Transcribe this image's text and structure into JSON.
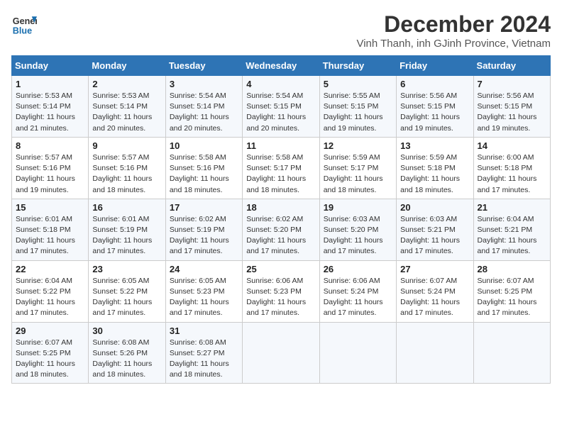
{
  "header": {
    "logo_line1": "General",
    "logo_line2": "Blue",
    "title": "December 2024",
    "subtitle": "Vinh Thanh, inh GJinh Province, Vietnam"
  },
  "calendar": {
    "headers": [
      "Sunday",
      "Monday",
      "Tuesday",
      "Wednesday",
      "Thursday",
      "Friday",
      "Saturday"
    ],
    "weeks": [
      [
        {
          "day": "1",
          "info": "Sunrise: 5:53 AM\nSunset: 5:14 PM\nDaylight: 11 hours\nand 21 minutes."
        },
        {
          "day": "2",
          "info": "Sunrise: 5:53 AM\nSunset: 5:14 PM\nDaylight: 11 hours\nand 20 minutes."
        },
        {
          "day": "3",
          "info": "Sunrise: 5:54 AM\nSunset: 5:14 PM\nDaylight: 11 hours\nand 20 minutes."
        },
        {
          "day": "4",
          "info": "Sunrise: 5:54 AM\nSunset: 5:15 PM\nDaylight: 11 hours\nand 20 minutes."
        },
        {
          "day": "5",
          "info": "Sunrise: 5:55 AM\nSunset: 5:15 PM\nDaylight: 11 hours\nand 19 minutes."
        },
        {
          "day": "6",
          "info": "Sunrise: 5:56 AM\nSunset: 5:15 PM\nDaylight: 11 hours\nand 19 minutes."
        },
        {
          "day": "7",
          "info": "Sunrise: 5:56 AM\nSunset: 5:15 PM\nDaylight: 11 hours\nand 19 minutes."
        }
      ],
      [
        {
          "day": "8",
          "info": "Sunrise: 5:57 AM\nSunset: 5:16 PM\nDaylight: 11 hours\nand 19 minutes."
        },
        {
          "day": "9",
          "info": "Sunrise: 5:57 AM\nSunset: 5:16 PM\nDaylight: 11 hours\nand 18 minutes."
        },
        {
          "day": "10",
          "info": "Sunrise: 5:58 AM\nSunset: 5:16 PM\nDaylight: 11 hours\nand 18 minutes."
        },
        {
          "day": "11",
          "info": "Sunrise: 5:58 AM\nSunset: 5:17 PM\nDaylight: 11 hours\nand 18 minutes."
        },
        {
          "day": "12",
          "info": "Sunrise: 5:59 AM\nSunset: 5:17 PM\nDaylight: 11 hours\nand 18 minutes."
        },
        {
          "day": "13",
          "info": "Sunrise: 5:59 AM\nSunset: 5:18 PM\nDaylight: 11 hours\nand 18 minutes."
        },
        {
          "day": "14",
          "info": "Sunrise: 6:00 AM\nSunset: 5:18 PM\nDaylight: 11 hours\nand 17 minutes."
        }
      ],
      [
        {
          "day": "15",
          "info": "Sunrise: 6:01 AM\nSunset: 5:18 PM\nDaylight: 11 hours\nand 17 minutes."
        },
        {
          "day": "16",
          "info": "Sunrise: 6:01 AM\nSunset: 5:19 PM\nDaylight: 11 hours\nand 17 minutes."
        },
        {
          "day": "17",
          "info": "Sunrise: 6:02 AM\nSunset: 5:19 PM\nDaylight: 11 hours\nand 17 minutes."
        },
        {
          "day": "18",
          "info": "Sunrise: 6:02 AM\nSunset: 5:20 PM\nDaylight: 11 hours\nand 17 minutes."
        },
        {
          "day": "19",
          "info": "Sunrise: 6:03 AM\nSunset: 5:20 PM\nDaylight: 11 hours\nand 17 minutes."
        },
        {
          "day": "20",
          "info": "Sunrise: 6:03 AM\nSunset: 5:21 PM\nDaylight: 11 hours\nand 17 minutes."
        },
        {
          "day": "21",
          "info": "Sunrise: 6:04 AM\nSunset: 5:21 PM\nDaylight: 11 hours\nand 17 minutes."
        }
      ],
      [
        {
          "day": "22",
          "info": "Sunrise: 6:04 AM\nSunset: 5:22 PM\nDaylight: 11 hours\nand 17 minutes."
        },
        {
          "day": "23",
          "info": "Sunrise: 6:05 AM\nSunset: 5:22 PM\nDaylight: 11 hours\nand 17 minutes."
        },
        {
          "day": "24",
          "info": "Sunrise: 6:05 AM\nSunset: 5:23 PM\nDaylight: 11 hours\nand 17 minutes."
        },
        {
          "day": "25",
          "info": "Sunrise: 6:06 AM\nSunset: 5:23 PM\nDaylight: 11 hours\nand 17 minutes."
        },
        {
          "day": "26",
          "info": "Sunrise: 6:06 AM\nSunset: 5:24 PM\nDaylight: 11 hours\nand 17 minutes."
        },
        {
          "day": "27",
          "info": "Sunrise: 6:07 AM\nSunset: 5:24 PM\nDaylight: 11 hours\nand 17 minutes."
        },
        {
          "day": "28",
          "info": "Sunrise: 6:07 AM\nSunset: 5:25 PM\nDaylight: 11 hours\nand 17 minutes."
        }
      ],
      [
        {
          "day": "29",
          "info": "Sunrise: 6:07 AM\nSunset: 5:25 PM\nDaylight: 11 hours\nand 18 minutes."
        },
        {
          "day": "30",
          "info": "Sunrise: 6:08 AM\nSunset: 5:26 PM\nDaylight: 11 hours\nand 18 minutes."
        },
        {
          "day": "31",
          "info": "Sunrise: 6:08 AM\nSunset: 5:27 PM\nDaylight: 11 hours\nand 18 minutes."
        },
        {
          "day": "",
          "info": ""
        },
        {
          "day": "",
          "info": ""
        },
        {
          "day": "",
          "info": ""
        },
        {
          "day": "",
          "info": ""
        }
      ]
    ]
  }
}
